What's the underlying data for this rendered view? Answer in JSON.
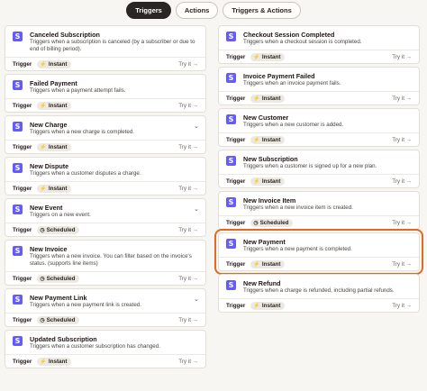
{
  "tabs": [
    "Triggers",
    "Actions",
    "Triggers & Actions"
  ],
  "trigger_label": "Trigger",
  "try_label": "Try it →",
  "left": [
    {
      "title": "Canceled Subscription",
      "desc": "Triggers when a subscription is canceled (by a subscriber or due to end of billing period).",
      "badge": "Instant",
      "expanded": true
    },
    {
      "title": "Failed Payment",
      "desc": "Triggers when a payment attempt fails.",
      "badge": "Instant",
      "expanded": true
    },
    {
      "title": "New Charge",
      "desc": "Triggers when a new charge is completed.",
      "badge": "Instant",
      "expanded": false
    },
    {
      "title": "New Dispute",
      "desc": "Triggers when a customer disputes a charge.",
      "badge": "Instant",
      "expanded": true
    },
    {
      "title": "New Event",
      "desc": "Triggers on a new event.",
      "badge": "Scheduled",
      "expanded": false
    },
    {
      "title": "New Invoice",
      "desc": "Triggers when a new invoice. You can filter based on the invoice's status. (supports line items)",
      "badge": "Scheduled",
      "expanded": true
    },
    {
      "title": "New Payment Link",
      "desc": "Triggers when a new payment link is created.",
      "badge": "Scheduled",
      "expanded": false
    },
    {
      "title": "Updated Subscription",
      "desc": "Triggers when a customer subscription has changed.",
      "badge": "Instant",
      "expanded": true
    }
  ],
  "right": [
    {
      "title": "Checkout Session Completed",
      "desc": "Triggers when a checkout session is completed.",
      "badge": "Instant",
      "expanded": true
    },
    {
      "title": "Invoice Payment Failed",
      "desc": "Triggers when an invoice payment fails.",
      "badge": "Instant",
      "expanded": true
    },
    {
      "title": "New Customer",
      "desc": "Triggers when a new customer is added.",
      "badge": "Instant",
      "expanded": true
    },
    {
      "title": "New Subscription",
      "desc": "Triggers when a customer is signed up for a new plan.",
      "badge": "Instant",
      "expanded": true
    },
    {
      "title": "New Invoice Item",
      "desc": "Triggers when a new invoice item is created.",
      "badge": "Scheduled",
      "expanded": true
    },
    {
      "title": "New Payment",
      "desc": "Triggers when a new payment is completed.",
      "badge": "Instant",
      "expanded": true,
      "highlight": true
    },
    {
      "title": "New Refund",
      "desc": "Triggers when a charge is refunded, including partial refunds.",
      "badge": "Instant",
      "expanded": true
    }
  ],
  "icons": {
    "logo": "stripe-s-logo",
    "instant": "lightning-icon",
    "scheduled": "clock-icon",
    "chevron": "chevron-down-icon"
  },
  "colors": {
    "highlight": "#e2691f",
    "logo": "#635bff",
    "active_tab": "#2b2523"
  }
}
